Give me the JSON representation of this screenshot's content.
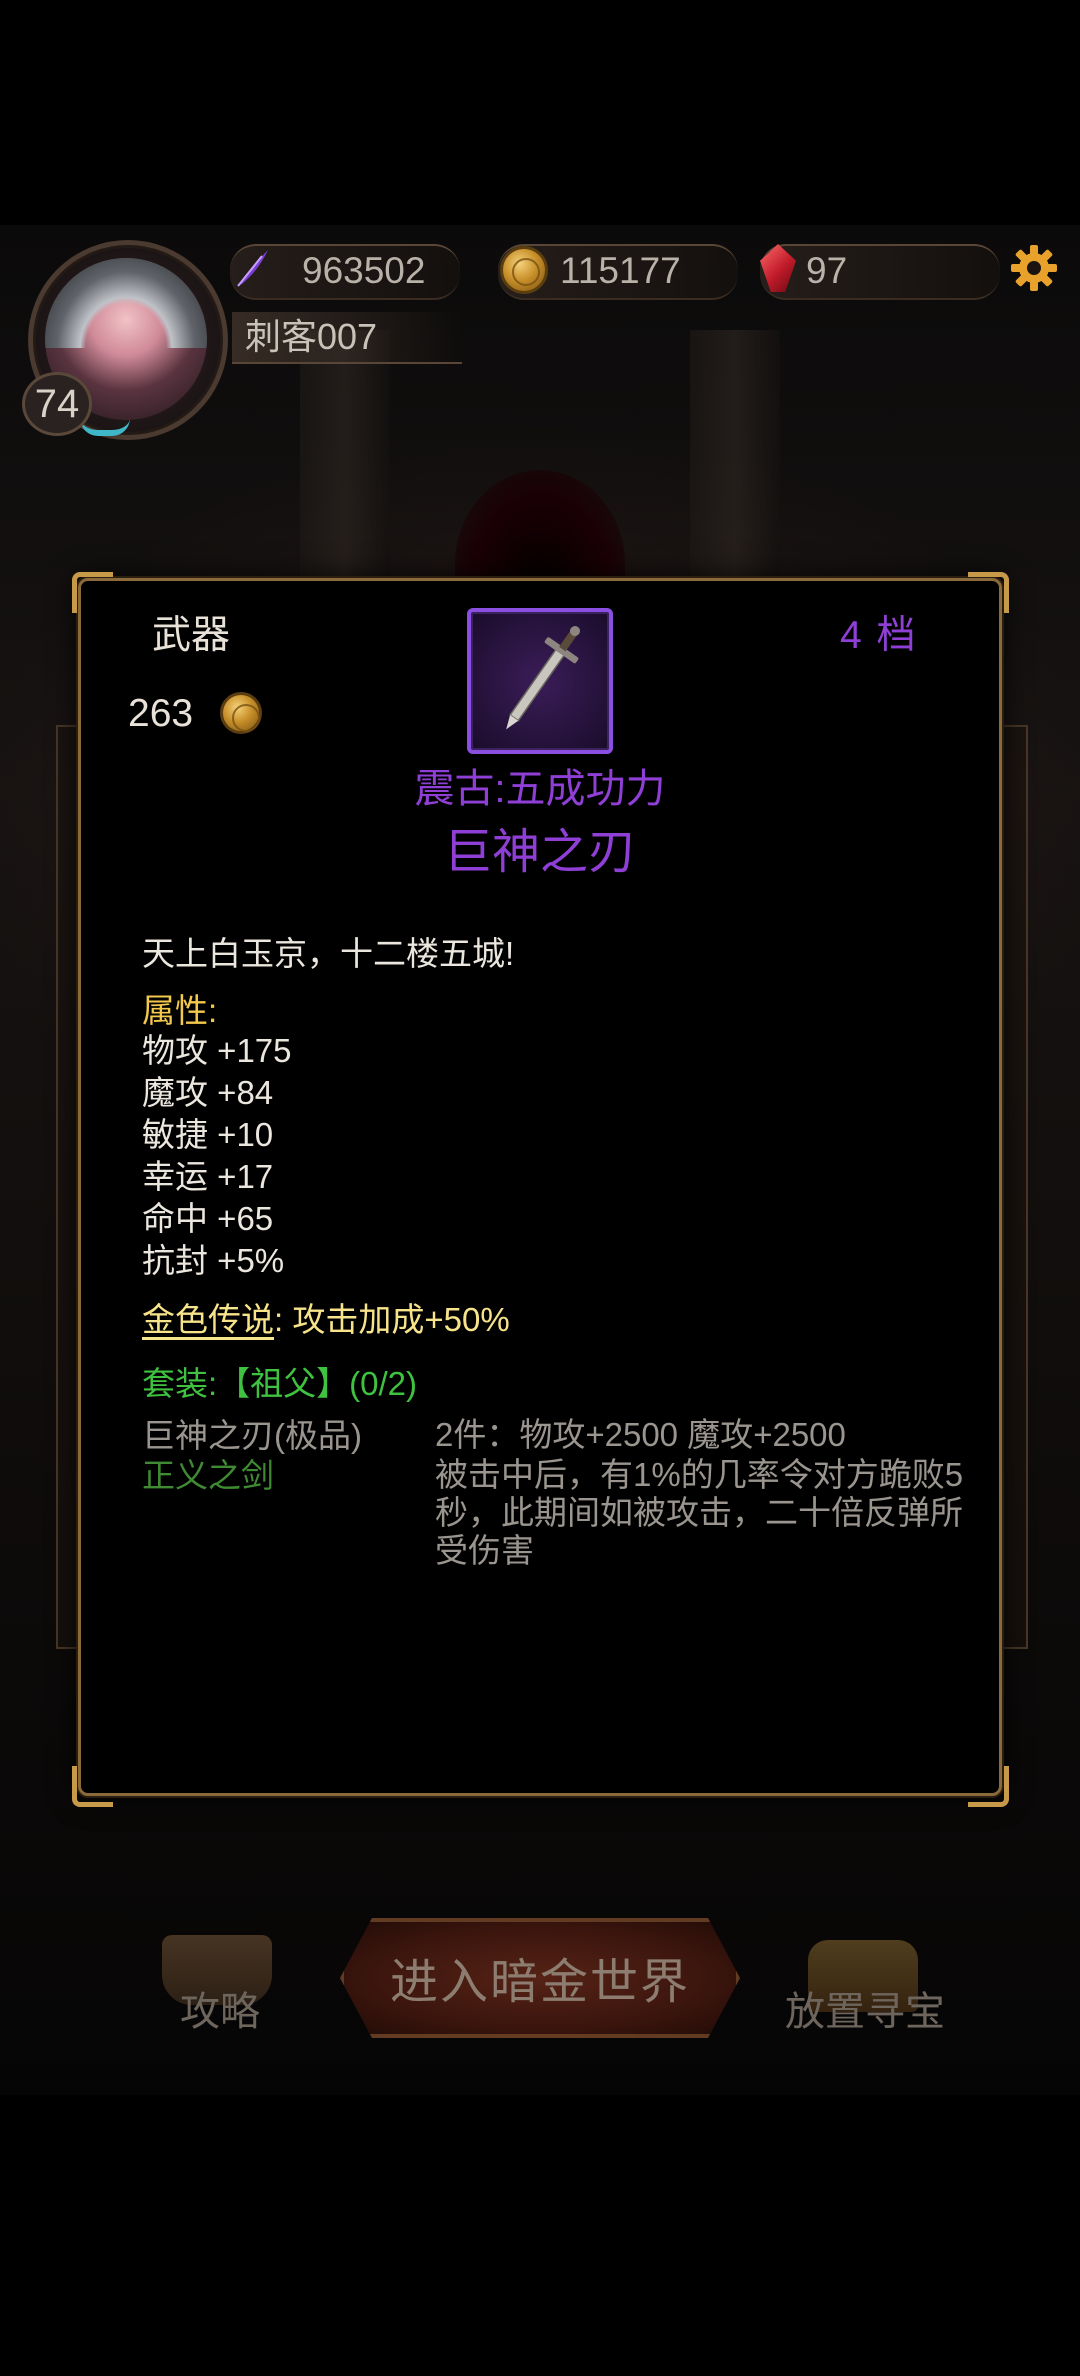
{
  "header": {
    "currency_primary": "963502",
    "gold": "115177",
    "gems": "97",
    "player_name": "刺客007",
    "level": "74",
    "xp_fraction": 0.25
  },
  "item": {
    "type": "武器",
    "price": "263",
    "tier": "4 档",
    "subtitle": "震古:五成功力",
    "name": "巨神之刃",
    "flavor": "天上白玉京，十二楼五城!",
    "attr_title": "属性:",
    "stats": [
      "物攻 +175",
      "魔攻 +84",
      "敏捷 +10",
      "幸运 +17",
      "命中 +65",
      "抗封 +5%"
    ],
    "legend_label": "金色传说",
    "legend_colon": ":",
    "legend_effect": "攻击加成+50%",
    "set_prefix": "套装:",
    "set_name": "【祖父】",
    "set_progress": "(0/2)",
    "set_pieces": [
      "巨神之刃(极品)",
      "正义之剑"
    ],
    "set_bonus_2": "2件：物攻+2500 魔攻+2500",
    "set_bonus_desc": "被击中后，有1%的几率令对方跪败5秒，此期间如被攻击，二十倍反弹所受伤害"
  },
  "bottom_nav": {
    "guide": "攻略",
    "enter": "进入暗金世界",
    "treasure": "放置寻宝"
  },
  "colors": {
    "epic_purple": "#8f3fd6",
    "legend_gold": "#f7e38a",
    "attr_yellow": "#f2c94c",
    "set_green": "#3fc23f",
    "frame_gold": "#c79a4a"
  },
  "icons": {
    "primary_currency": "purple-feather-icon",
    "gold": "gold-coin-icon",
    "gems": "red-gem-icon",
    "settings": "gear-icon",
    "item": "sword-icon"
  }
}
